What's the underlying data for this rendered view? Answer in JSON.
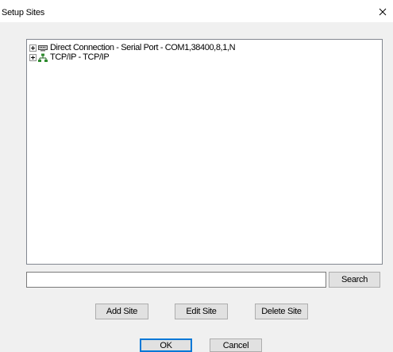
{
  "window": {
    "title": "Setup Sites"
  },
  "tree": {
    "items": [
      {
        "label": "Direct Connection - Serial Port - COM1,38400,8,1,N",
        "icon": "serial-port-icon",
        "expander": "plus"
      },
      {
        "label": "TCP/IP - TCP/IP",
        "icon": "network-icon",
        "expander": "plus"
      }
    ]
  },
  "search": {
    "value": "",
    "button_label": "Search"
  },
  "site_actions": {
    "add_label": "Add Site",
    "edit_label": "Edit Site",
    "delete_label": "Delete Site"
  },
  "dialog_buttons": {
    "ok_label": "OK",
    "cancel_label": "Cancel"
  },
  "colors": {
    "client_background": "#f0f0f0",
    "accent_focus": "#0078d7",
    "button_face": "#e1e1e1",
    "network_icon": "#2e8b2e"
  }
}
